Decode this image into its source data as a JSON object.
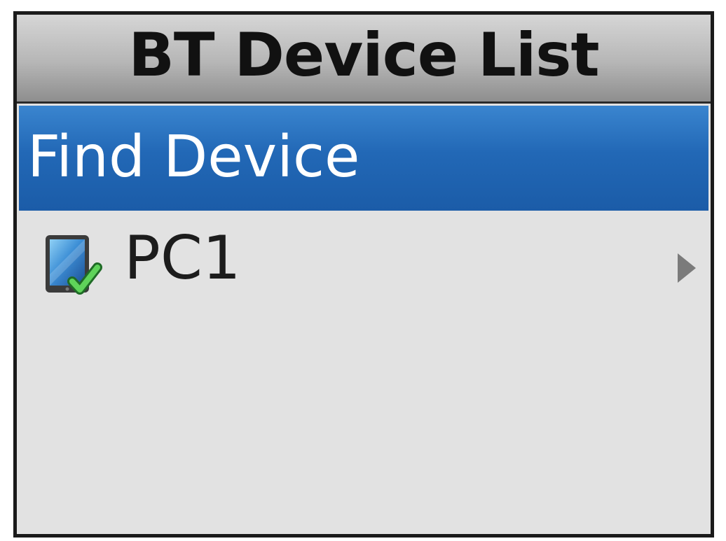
{
  "header": {
    "title": "BT Device List"
  },
  "menu": {
    "items": [
      {
        "label": "Find Device",
        "selected": true
      },
      {
        "label": "PC1",
        "icon": "paired-device-check-icon",
        "trailing_icon": "chevron-right-icon",
        "selected": false
      }
    ]
  },
  "colors": {
    "selection": "#2268b6",
    "title_bar": "#b6b6b6",
    "background": "#e2e2e2",
    "check": "#3cb044"
  }
}
